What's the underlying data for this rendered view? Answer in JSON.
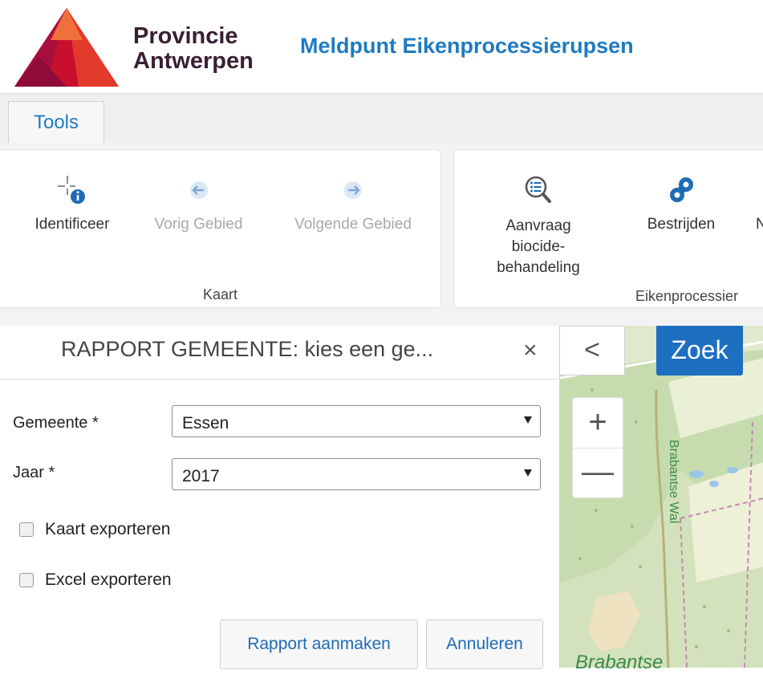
{
  "header": {
    "logo_line1": "Provincie",
    "logo_line2": "Antwerpen",
    "app_title": "Meldpunt Eikenprocessierupsen"
  },
  "ribbon": {
    "tab": "Tools",
    "groups": [
      {
        "label": "Kaart",
        "tools": [
          {
            "label": "Identificeer",
            "icon": "identify-icon",
            "enabled": true
          },
          {
            "label": "Vorig Gebied",
            "icon": "arrow-left-icon",
            "enabled": false
          },
          {
            "label": "Volgende Gebied",
            "icon": "arrow-right-icon",
            "enabled": false
          }
        ]
      },
      {
        "label": "Eikenprocessier",
        "tools": [
          {
            "label_lines": [
              "Aanvraag",
              "biocide-",
              "behandeling"
            ],
            "icon": "search-list-icon",
            "enabled": true
          },
          {
            "label": "Bestrijden",
            "icon": "caterpillar-icon",
            "enabled": true
          },
          {
            "label": "N",
            "icon": "",
            "enabled": true
          }
        ]
      }
    ]
  },
  "panel": {
    "title": "RAPPORT GEMEENTE: kies een ge...",
    "close": "×",
    "fields": [
      {
        "label": "Gemeente *",
        "value": "Essen"
      },
      {
        "label": "Jaar *",
        "value": "2017"
      }
    ],
    "checkboxes": [
      {
        "label": "Kaart exporteren",
        "checked": false
      },
      {
        "label": "Excel exporteren",
        "checked": false
      }
    ],
    "buttons": {
      "create": "Rapport aanmaken",
      "cancel": "Annuleren"
    }
  },
  "map": {
    "collapse": "<",
    "search": "Zoek",
    "zoom_in": "+",
    "zoom_out": "—",
    "label_vertical": "Brabantse Wal",
    "label_bottom": "Brabantse"
  },
  "colors": {
    "accent": "#1f7bc1",
    "zoek_button": "#1f6fc0",
    "logo_red": "#c8102e"
  }
}
